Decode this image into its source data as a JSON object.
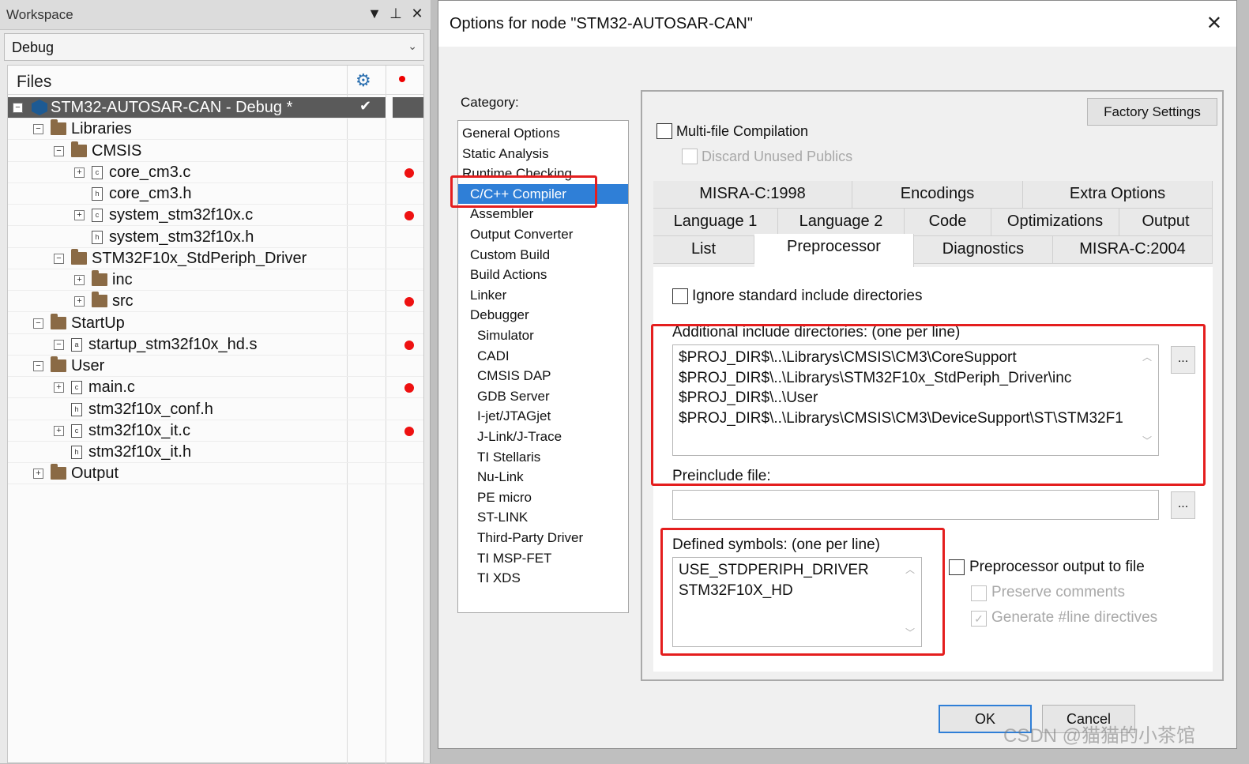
{
  "workspace": {
    "title": "Workspace",
    "controls": [
      "▼",
      "⊥",
      "✕"
    ],
    "config": "Debug",
    "files_label": "Files",
    "tree": [
      {
        "label": "STM32-AUTOSAR-CAN - Debug *",
        "kind": "project",
        "check": "✔"
      },
      {
        "label": "Libraries",
        "kind": "folder"
      },
      {
        "label": "CMSIS",
        "kind": "folder"
      },
      {
        "label": "core_cm3.c",
        "kind": "c",
        "dot": true
      },
      {
        "label": "core_cm3.h",
        "kind": "h"
      },
      {
        "label": "system_stm32f10x.c",
        "kind": "c",
        "dot": true
      },
      {
        "label": "system_stm32f10x.h",
        "kind": "h"
      },
      {
        "label": "STM32F10x_StdPeriph_Driver",
        "kind": "folder"
      },
      {
        "label": "inc",
        "kind": "folder"
      },
      {
        "label": "src",
        "kind": "folder",
        "dot": true
      },
      {
        "label": "StartUp",
        "kind": "folder"
      },
      {
        "label": "startup_stm32f10x_hd.s",
        "kind": "s",
        "dot": true
      },
      {
        "label": "User",
        "kind": "folder"
      },
      {
        "label": "main.c",
        "kind": "c",
        "dot": true
      },
      {
        "label": "stm32f10x_conf.h",
        "kind": "h"
      },
      {
        "label": "stm32f10x_it.c",
        "kind": "c",
        "dot": true
      },
      {
        "label": "stm32f10x_it.h",
        "kind": "h"
      },
      {
        "label": "Output",
        "kind": "folder"
      }
    ]
  },
  "dialog": {
    "title": "Options for node \"STM32-AUTOSAR-CAN\"",
    "close": "✕",
    "category_label": "Category:",
    "categories": [
      "General Options",
      "Static Analysis",
      "Runtime Checking",
      "C/C++ Compiler",
      "Assembler",
      "Output Converter",
      "Custom Build",
      "Build Actions",
      "Linker",
      "Debugger",
      "Simulator",
      "CADI",
      "CMSIS DAP",
      "GDB Server",
      "I-jet/JTAGjet",
      "J-Link/J-Trace",
      "TI Stellaris",
      "Nu-Link",
      "PE micro",
      "ST-LINK",
      "Third-Party Driver",
      "TI MSP-FET",
      "TI XDS"
    ],
    "selected_category": "C/C++ Compiler",
    "factory_settings": "Factory Settings",
    "multi_file": "Multi-file Compilation",
    "discard_unused": "Discard Unused Publics",
    "tabs_row1": [
      "MISRA-C:1998",
      "Encodings",
      "Extra Options"
    ],
    "tabs_row2": [
      "Language 1",
      "Language 2",
      "Code",
      "Optimizations",
      "Output"
    ],
    "tabs_row3": [
      "List",
      "Preprocessor",
      "Diagnostics",
      "MISRA-C:2004"
    ],
    "active_tab": "Preprocessor",
    "ignore_std": "Ignore standard include directories",
    "include_label": "Additional include directories: (one per line)",
    "include_dirs": [
      "$PROJ_DIR$\\..\\Librarys\\CMSIS\\CM3\\CoreSupport",
      "$PROJ_DIR$\\..\\Librarys\\STM32F10x_StdPeriph_Driver\\inc",
      "$PROJ_DIR$\\..\\User",
      "$PROJ_DIR$\\..\\Librarys\\CMSIS\\CM3\\DeviceSupport\\ST\\STM32F1"
    ],
    "browse": "...",
    "preinclude_label": "Preinclude file:",
    "preinclude_value": "",
    "defined_label": "Defined symbols: (one per line)",
    "defined_symbols": [
      "USE_STDPERIPH_DRIVER",
      "STM32F10X_HD"
    ],
    "pp_output": "Preprocessor output to file",
    "preserve_comments": "Preserve comments",
    "gen_line": "Generate #line directives",
    "ok": "OK",
    "cancel": "Cancel"
  },
  "watermark": "CSDN @猫猫的小茶馆",
  "colors": {
    "selection": "#2f7fd7",
    "highlight": "#e41e1e",
    "breakpoint": "#e11111"
  }
}
